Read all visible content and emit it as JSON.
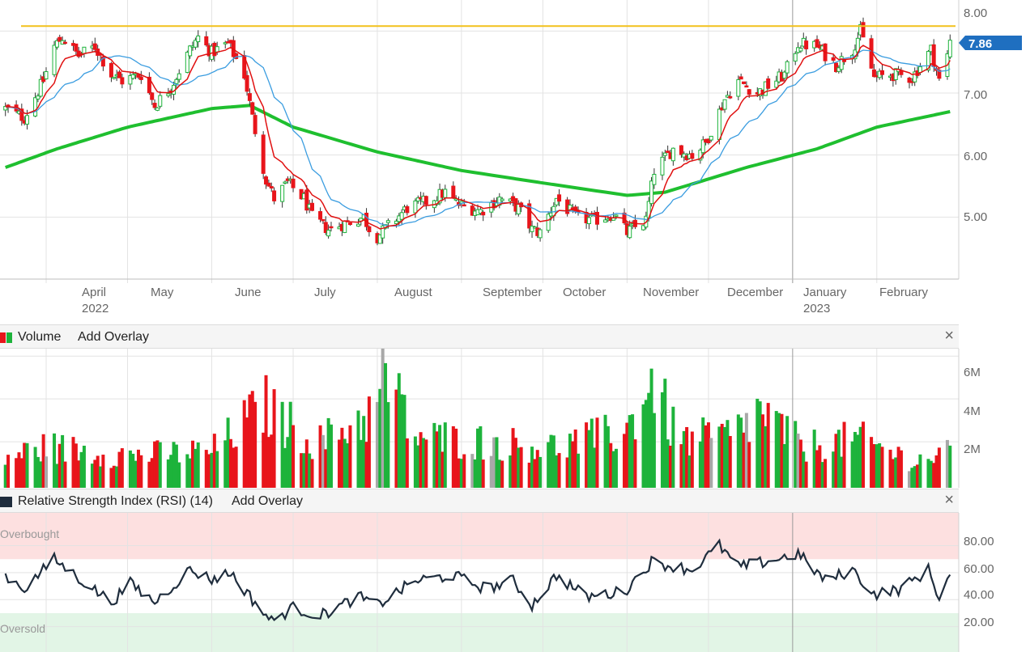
{
  "colors": {
    "up": "#1db33b",
    "down": "#e8151b",
    "neutral": "#a8a8a8",
    "ema_fast": "#e01010",
    "sma_mid": "#3b9de0",
    "sma_long": "#1fbf2f",
    "resistance": "#f2c11c",
    "price_tag": "#1f6fc0",
    "rsi_line": "#1f2d3d",
    "overbought_fill": "#fde0e0",
    "oversold_fill": "#e2f5e6"
  },
  "price_panel": {
    "last_price_label": "7.86",
    "y_ticks": [
      "8.00",
      "7.00",
      "6.00",
      "5.00"
    ],
    "months": [
      {
        "label": "April",
        "year": "2022"
      },
      {
        "label": "May",
        "year": ""
      },
      {
        "label": "June",
        "year": ""
      },
      {
        "label": "July",
        "year": ""
      },
      {
        "label": "August",
        "year": ""
      },
      {
        "label": "September",
        "year": ""
      },
      {
        "label": "October",
        "year": ""
      },
      {
        "label": "November",
        "year": ""
      },
      {
        "label": "December",
        "year": ""
      },
      {
        "label": "January",
        "year": "2023"
      },
      {
        "label": "February",
        "year": ""
      }
    ]
  },
  "volume_panel": {
    "title": "Volume",
    "overlay_label": "Add Overlay",
    "close_label": "×",
    "y_ticks": [
      "6M",
      "4M",
      "2M"
    ]
  },
  "rsi_panel": {
    "title": "Relative Strength Index (RSI) (14)",
    "overlay_label": "Add Overlay",
    "close_label": "×",
    "y_ticks": [
      "80.00",
      "60.00",
      "40.00",
      "20.00"
    ],
    "overbought_label": "Overbought",
    "oversold_label": "Oversold"
  },
  "chart_data": {
    "type": "candlestick",
    "resistance_level": 8.08,
    "last_price": 7.86,
    "price_key_points": [
      [
        "2022-03-17",
        6.75
      ],
      [
        "2022-03-24",
        6.6
      ],
      [
        "2022-03-31",
        7.2
      ],
      [
        "2022-04-04",
        7.75
      ],
      [
        "2022-04-07",
        7.9
      ],
      [
        "2022-04-13",
        7.6
      ],
      [
        "2022-04-19",
        7.75
      ],
      [
        "2022-04-25",
        7.3
      ],
      [
        "2022-04-29",
        7.2
      ],
      [
        "2022-05-06",
        7.3
      ],
      [
        "2022-05-11",
        6.8
      ],
      [
        "2022-05-17",
        7.1
      ],
      [
        "2022-05-24",
        7.7
      ],
      [
        "2022-05-27",
        7.9
      ],
      [
        "2022-06-01",
        7.65
      ],
      [
        "2022-06-07",
        7.8
      ],
      [
        "2022-06-13",
        7.3
      ],
      [
        "2022-06-16",
        6.6
      ],
      [
        "2022-06-21",
        5.6
      ],
      [
        "2022-06-24",
        5.3
      ],
      [
        "2022-06-29",
        5.55
      ],
      [
        "2022-07-05",
        5.3
      ],
      [
        "2022-07-08",
        5.0
      ],
      [
        "2022-07-14",
        4.8
      ],
      [
        "2022-07-20",
        4.9
      ],
      [
        "2022-07-27",
        5.0
      ],
      [
        "2022-07-31",
        4.65
      ],
      [
        "2022-08-05",
        4.85
      ],
      [
        "2022-08-12",
        5.15
      ],
      [
        "2022-08-19",
        5.25
      ],
      [
        "2022-08-26",
        5.4
      ],
      [
        "2022-08-31",
        5.2
      ],
      [
        "2022-09-08",
        5.1
      ],
      [
        "2022-09-15",
        5.3
      ],
      [
        "2022-09-22",
        5.15
      ],
      [
        "2022-09-27",
        4.8
      ],
      [
        "2022-09-30",
        4.75
      ],
      [
        "2022-10-06",
        5.3
      ],
      [
        "2022-10-13",
        5.0
      ],
      [
        "2022-10-20",
        4.95
      ],
      [
        "2022-10-27",
        5.05
      ],
      [
        "2022-11-01",
        4.75
      ],
      [
        "2022-11-08",
        4.95
      ],
      [
        "2022-11-11",
        5.75
      ],
      [
        "2022-11-18",
        6.1
      ],
      [
        "2022-11-25",
        6.0
      ],
      [
        "2022-11-30",
        6.2
      ],
      [
        "2022-12-07",
        6.9
      ],
      [
        "2022-12-12",
        7.2
      ],
      [
        "2022-12-19",
        7.0
      ],
      [
        "2022-12-29",
        7.3
      ],
      [
        "2023-01-03",
        7.8
      ],
      [
        "2023-01-10",
        7.75
      ],
      [
        "2023-01-17",
        7.45
      ],
      [
        "2023-01-23",
        7.7
      ],
      [
        "2023-01-26",
        8.0
      ],
      [
        "2023-01-31",
        7.25
      ],
      [
        "2023-02-07",
        7.3
      ],
      [
        "2023-02-14",
        7.25
      ],
      [
        "2023-02-21",
        7.7
      ],
      [
        "2023-02-24",
        7.2
      ],
      [
        "2023-02-27",
        7.6
      ],
      [
        "2023-02-28",
        7.86
      ]
    ],
    "sma_long_key_points": [
      [
        "2022-03-17",
        5.8
      ],
      [
        "2022-04-05",
        6.1
      ],
      [
        "2022-05-01",
        6.45
      ],
      [
        "2022-06-01",
        6.75
      ],
      [
        "2022-06-15",
        6.8
      ],
      [
        "2022-07-01",
        6.45
      ],
      [
        "2022-08-01",
        6.05
      ],
      [
        "2022-09-01",
        5.75
      ],
      [
        "2022-10-01",
        5.55
      ],
      [
        "2022-11-01",
        5.35
      ],
      [
        "2022-11-15",
        5.4
      ],
      [
        "2022-12-15",
        5.8
      ],
      [
        "2023-01-10",
        6.1
      ],
      [
        "2023-02-01",
        6.45
      ],
      [
        "2023-02-28",
        6.7
      ]
    ],
    "volume_key_points_millions": [
      [
        "2022-03-17",
        1.5
      ],
      [
        "2022-04-01",
        2.0
      ],
      [
        "2022-05-01",
        1.6
      ],
      [
        "2022-06-01",
        1.8
      ],
      [
        "2022-06-15",
        3.4
      ],
      [
        "2022-06-20",
        4.1
      ],
      [
        "2022-06-25",
        3.5
      ],
      [
        "2022-07-10",
        2.2
      ],
      [
        "2022-08-01",
        3.8
      ],
      [
        "2022-08-03",
        5.8
      ],
      [
        "2022-08-15",
        2.5
      ],
      [
        "2022-09-15",
        2.2
      ],
      [
        "2022-10-05",
        2.0
      ],
      [
        "2022-11-01",
        2.8
      ],
      [
        "2022-11-10",
        5.3
      ],
      [
        "2022-11-20",
        2.3
      ],
      [
        "2022-12-10",
        2.6
      ],
      [
        "2022-12-20",
        3.7
      ],
      [
        "2023-01-05",
        2.0
      ],
      [
        "2023-01-25",
        2.4
      ],
      [
        "2023-02-15",
        1.3
      ],
      [
        "2023-02-28",
        1.7
      ]
    ],
    "rsi_key_points": [
      [
        "2022-03-17",
        58
      ],
      [
        "2022-03-24",
        48
      ],
      [
        "2022-04-04",
        70
      ],
      [
        "2022-04-13",
        56
      ],
      [
        "2022-04-25",
        38
      ],
      [
        "2022-05-02",
        52
      ],
      [
        "2022-05-11",
        38
      ],
      [
        "2022-05-24",
        62
      ],
      [
        "2022-06-01",
        55
      ],
      [
        "2022-06-08",
        60
      ],
      [
        "2022-06-16",
        40
      ],
      [
        "2022-06-23",
        24
      ],
      [
        "2022-07-01",
        34
      ],
      [
        "2022-07-11",
        28
      ],
      [
        "2022-07-25",
        42
      ],
      [
        "2022-08-01",
        36
      ],
      [
        "2022-08-15",
        54
      ],
      [
        "2022-08-29",
        58
      ],
      [
        "2022-09-10",
        48
      ],
      [
        "2022-09-20",
        54
      ],
      [
        "2022-09-27",
        36
      ],
      [
        "2022-10-06",
        58
      ],
      [
        "2022-10-17",
        42
      ],
      [
        "2022-10-31",
        46
      ],
      [
        "2022-11-10",
        68
      ],
      [
        "2022-11-25",
        62
      ],
      [
        "2022-12-05",
        80
      ],
      [
        "2022-12-12",
        64
      ],
      [
        "2022-12-22",
        68
      ],
      [
        "2023-01-03",
        74
      ],
      [
        "2023-01-13",
        54
      ],
      [
        "2023-01-23",
        62
      ],
      [
        "2023-01-31",
        44
      ],
      [
        "2023-02-10",
        48
      ],
      [
        "2023-02-20",
        62
      ],
      [
        "2023-02-24",
        42
      ],
      [
        "2023-02-28",
        58
      ]
    ],
    "rsi_overbought": 70,
    "rsi_oversold": 30,
    "x_range": [
      "2022-03-15",
      "2023-03-02"
    ],
    "price_ylim": [
      4.0,
      8.5
    ],
    "volume_ylim": [
      0,
      6.5
    ],
    "rsi_ylim": [
      0,
      100
    ],
    "grid": true
  }
}
